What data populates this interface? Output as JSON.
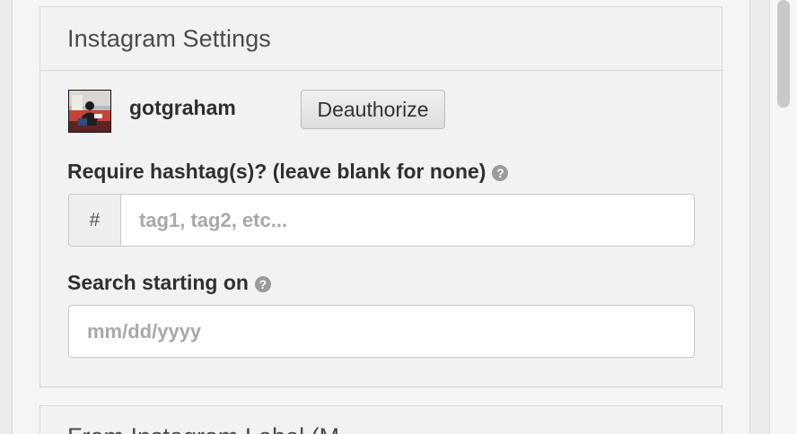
{
  "panel": {
    "title": "Instagram Settings"
  },
  "account": {
    "username": "gotgraham",
    "deauthorize_label": "Deauthorize",
    "avatar_icon": "profile-photo"
  },
  "hashtag": {
    "label": "Require hashtag(s)? (leave blank for none)",
    "prefix": "#",
    "placeholder": "tag1, tag2, etc...",
    "value": ""
  },
  "search_start": {
    "label": "Search starting on",
    "placeholder": "mm/dd/yyyy",
    "value": ""
  },
  "help_icon": "?",
  "next_section": {
    "title_visible_fragment": "From Instagram Label (M..."
  },
  "colors": {
    "panel_background": "#f2f2f2",
    "border": "#d8d8d8",
    "input_border": "#c7c7c7",
    "help_icon": "#9b9b9b"
  }
}
